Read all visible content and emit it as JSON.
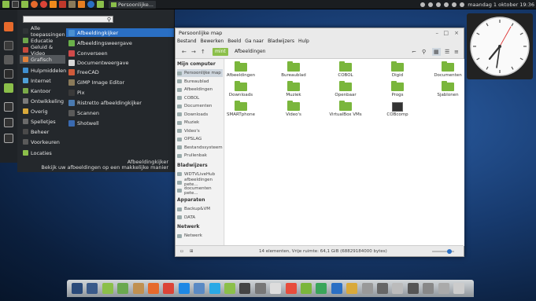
{
  "top_panel": {
    "menu_button_label": "M",
    "window_button_label": "Persoonlijke...",
    "datetime": "maandag  1 oktober 19:36",
    "icons": [
      "mint-menu-icon",
      "terminal-icon",
      "files-icon",
      "firefox-icon",
      "chrome-icon",
      "vlc-icon",
      "xmind-icon",
      "gimp-icon",
      "burp-icon",
      "firefox-2-icon",
      "files-2-icon"
    ]
  },
  "app_menu": {
    "search_placeholder": "",
    "categories": [
      {
        "label": "Alle toepassingen",
        "color": "#2f3336",
        "selected": false
      },
      {
        "label": "Educatie",
        "color": "#6da64b",
        "selected": false
      },
      {
        "label": "Geluid & Video",
        "color": "#c84a3c",
        "selected": false
      },
      {
        "label": "Grafisch",
        "color": "#e1813b",
        "selected": true
      },
      {
        "label": "Hulpmiddelen",
        "color": "#3f8fd0",
        "selected": false
      },
      {
        "label": "Internet",
        "color": "#4fa0d8",
        "selected": false
      },
      {
        "label": "Kantoor",
        "color": "#7aaa48",
        "selected": false
      },
      {
        "label": "Ontwikkeling",
        "color": "#7a7a7a",
        "selected": false
      },
      {
        "label": "Overig",
        "color": "#d9a93a",
        "selected": false
      },
      {
        "label": "Spelletjes",
        "color": "#6a6a6a",
        "selected": false
      },
      {
        "label": "Beheer",
        "color": "#4a4a4a",
        "selected": false
      },
      {
        "label": "Voorkeuren",
        "color": "#5a5a5a",
        "selected": false
      },
      {
        "label": "Locaties",
        "color": "#8bbf4a",
        "selected": false
      }
    ],
    "apps": [
      {
        "label": "Afbeeldingkijker",
        "color": "#4a90d0",
        "selected": true
      },
      {
        "label": "Afbeeldingsweergave",
        "color": "#6ab04a",
        "selected": false
      },
      {
        "label": "Converseen",
        "color": "#d04a4a",
        "selected": false
      },
      {
        "label": "Documentweergave",
        "color": "#d8d8d8",
        "selected": false
      },
      {
        "label": "FreeCAD",
        "color": "#d05a3a",
        "selected": false
      },
      {
        "label": "GIMP Image Editor",
        "color": "#8a7a5a",
        "selected": false
      },
      {
        "label": "Pix",
        "color": "#3a3a3a",
        "selected": false
      },
      {
        "label": "Ristretto afbeeldingkijker",
        "color": "#4a7ab0",
        "selected": false
      },
      {
        "label": "Scannen",
        "color": "#5a5a5a",
        "selected": false
      },
      {
        "label": "Shotwell",
        "color": "#3a6ab0",
        "selected": false
      }
    ],
    "desc_title": "Afbeeldingkijker",
    "desc_text": "Bekijk uw afbeeldingen op een makkelijke manier"
  },
  "file_manager": {
    "title": "Persoonlijke map",
    "menubar": [
      "Bestand",
      "Bewerken",
      "Beeld",
      "Ga naar",
      "Bladwijzers",
      "Hulp"
    ],
    "path": [
      "mint",
      "Afbeeldingen"
    ],
    "sidebar": {
      "sections": [
        {
          "header": "Mijn computer",
          "items": [
            "Persoonlijke map",
            "Bureaublad",
            "Afbeeldingen",
            "COBOL",
            "Documenten",
            "Downloads",
            "Muziek",
            "Video's",
            "OPSLAG",
            "Bestandssysteem",
            "Prullenbak"
          ]
        },
        {
          "header": "Bladwijzers",
          "items": [
            "WDTVLiveHub",
            "afbeeldingen pete...",
            "documenten pete..."
          ]
        },
        {
          "header": "Apparaten",
          "items": [
            "Backup&VM",
            "DATA"
          ]
        },
        {
          "header": "Netwerk",
          "items": [
            "Netwerk"
          ]
        }
      ],
      "selected": "Persoonlijke map"
    },
    "files": [
      {
        "name": "Afbeeldingen",
        "kind": "folder"
      },
      {
        "name": "Bureaublad",
        "kind": "folder"
      },
      {
        "name": "COBOL",
        "kind": "folder"
      },
      {
        "name": "Digid",
        "kind": "folder"
      },
      {
        "name": "Documenten",
        "kind": "folder"
      },
      {
        "name": "Downloads",
        "kind": "folder"
      },
      {
        "name": "Muziek",
        "kind": "folder"
      },
      {
        "name": "Openbaar",
        "kind": "folder"
      },
      {
        "name": "Progs",
        "kind": "folder"
      },
      {
        "name": "Sjablonen",
        "kind": "folder"
      },
      {
        "name": "SMARTphone",
        "kind": "folder"
      },
      {
        "name": "Video's",
        "kind": "folder"
      },
      {
        "name": "VirtualBox VMs",
        "kind": "folder"
      },
      {
        "name": "COBcomp",
        "kind": "terminal"
      }
    ],
    "status": "14 elementen, Vrije ruimte: 64,1 GiB (68829184000 bytes)",
    "accent": "#8bbf4a"
  },
  "dock_icons": [
    "desktop-icon",
    "screens-icon",
    "files-icon",
    "mint-icon",
    "archive-icon",
    "firefox-icon",
    "chrome-icon",
    "vlc-icon",
    "bird-icon",
    "skype-icon",
    "files-3-icon",
    "code-icon",
    "gear-icon",
    "disc-icon",
    "rocket-icon",
    "photo-icon",
    "spreadsheet-icon",
    "writer-icon",
    "draw-icon",
    "printer-icon",
    "disk-icon",
    "clock-icon",
    "player-icon",
    "power-icon",
    "pen-icon",
    "more-icon"
  ]
}
